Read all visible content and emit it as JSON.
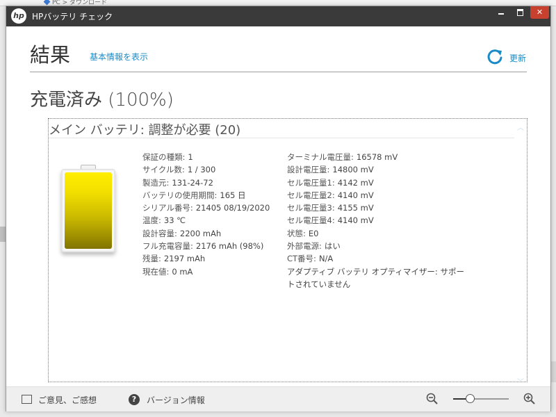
{
  "background": {
    "breadcrumb": "PC > ダウンロード"
  },
  "window": {
    "app_title": "HPバッテリ チェック",
    "logo_text": "hp",
    "controls": {
      "minimize": "–",
      "maximize": "□",
      "close": "✕"
    }
  },
  "header": {
    "title": "結果",
    "basic_info_link": "基本情報を表示",
    "refresh_label": "更新"
  },
  "status": {
    "charge": "充電済み (100%)"
  },
  "panel": {
    "title": "メイン バッテリ: 調整が必要 (20)",
    "battery_fill_fraction": 1.0,
    "left": [
      {
        "label": "保証の種類:",
        "value": "1"
      },
      {
        "label": "サイクル数:",
        "value": "1 / 300"
      },
      {
        "label": "製造元:",
        "value": "131-24-72"
      },
      {
        "label": "バッテリの使用期間:",
        "value": "165 日"
      },
      {
        "label": "シリアル番号:",
        "value": "21405 08/19/2020"
      },
      {
        "label": "温度:",
        "value": "33 ℃"
      },
      {
        "label": "設計容量:",
        "value": "2200 mAh"
      },
      {
        "label": "フル充電容量:",
        "value": "2176 mAh (98%)"
      },
      {
        "label": "残量:",
        "value": "2197 mAh"
      },
      {
        "label": "現在値:",
        "value": "0 mA"
      }
    ],
    "right": [
      {
        "label": "ターミナル電圧量:",
        "value": "16578 mV"
      },
      {
        "label": "設計電圧量:",
        "value": "14800 mV"
      },
      {
        "label": "セル電圧量1:",
        "value": "4142 mV"
      },
      {
        "label": "セル電圧量2:",
        "value": "4140 mV"
      },
      {
        "label": "セル電圧量3:",
        "value": "4155 mV"
      },
      {
        "label": "セル電圧量4:",
        "value": "4140 mV"
      },
      {
        "label": "状態:",
        "value": "E0"
      },
      {
        "label": "外部電源:",
        "value": "はい"
      },
      {
        "label": "CT番号:",
        "value": "N/A"
      }
    ],
    "optimizer_note": "アダプティブ バッテリ オプティマイザー: サポートされていません"
  },
  "footer": {
    "feedback_label": "ご意見、ご感想",
    "version_label": "バージョン情報",
    "zoom_level_fraction": 0.3
  }
}
